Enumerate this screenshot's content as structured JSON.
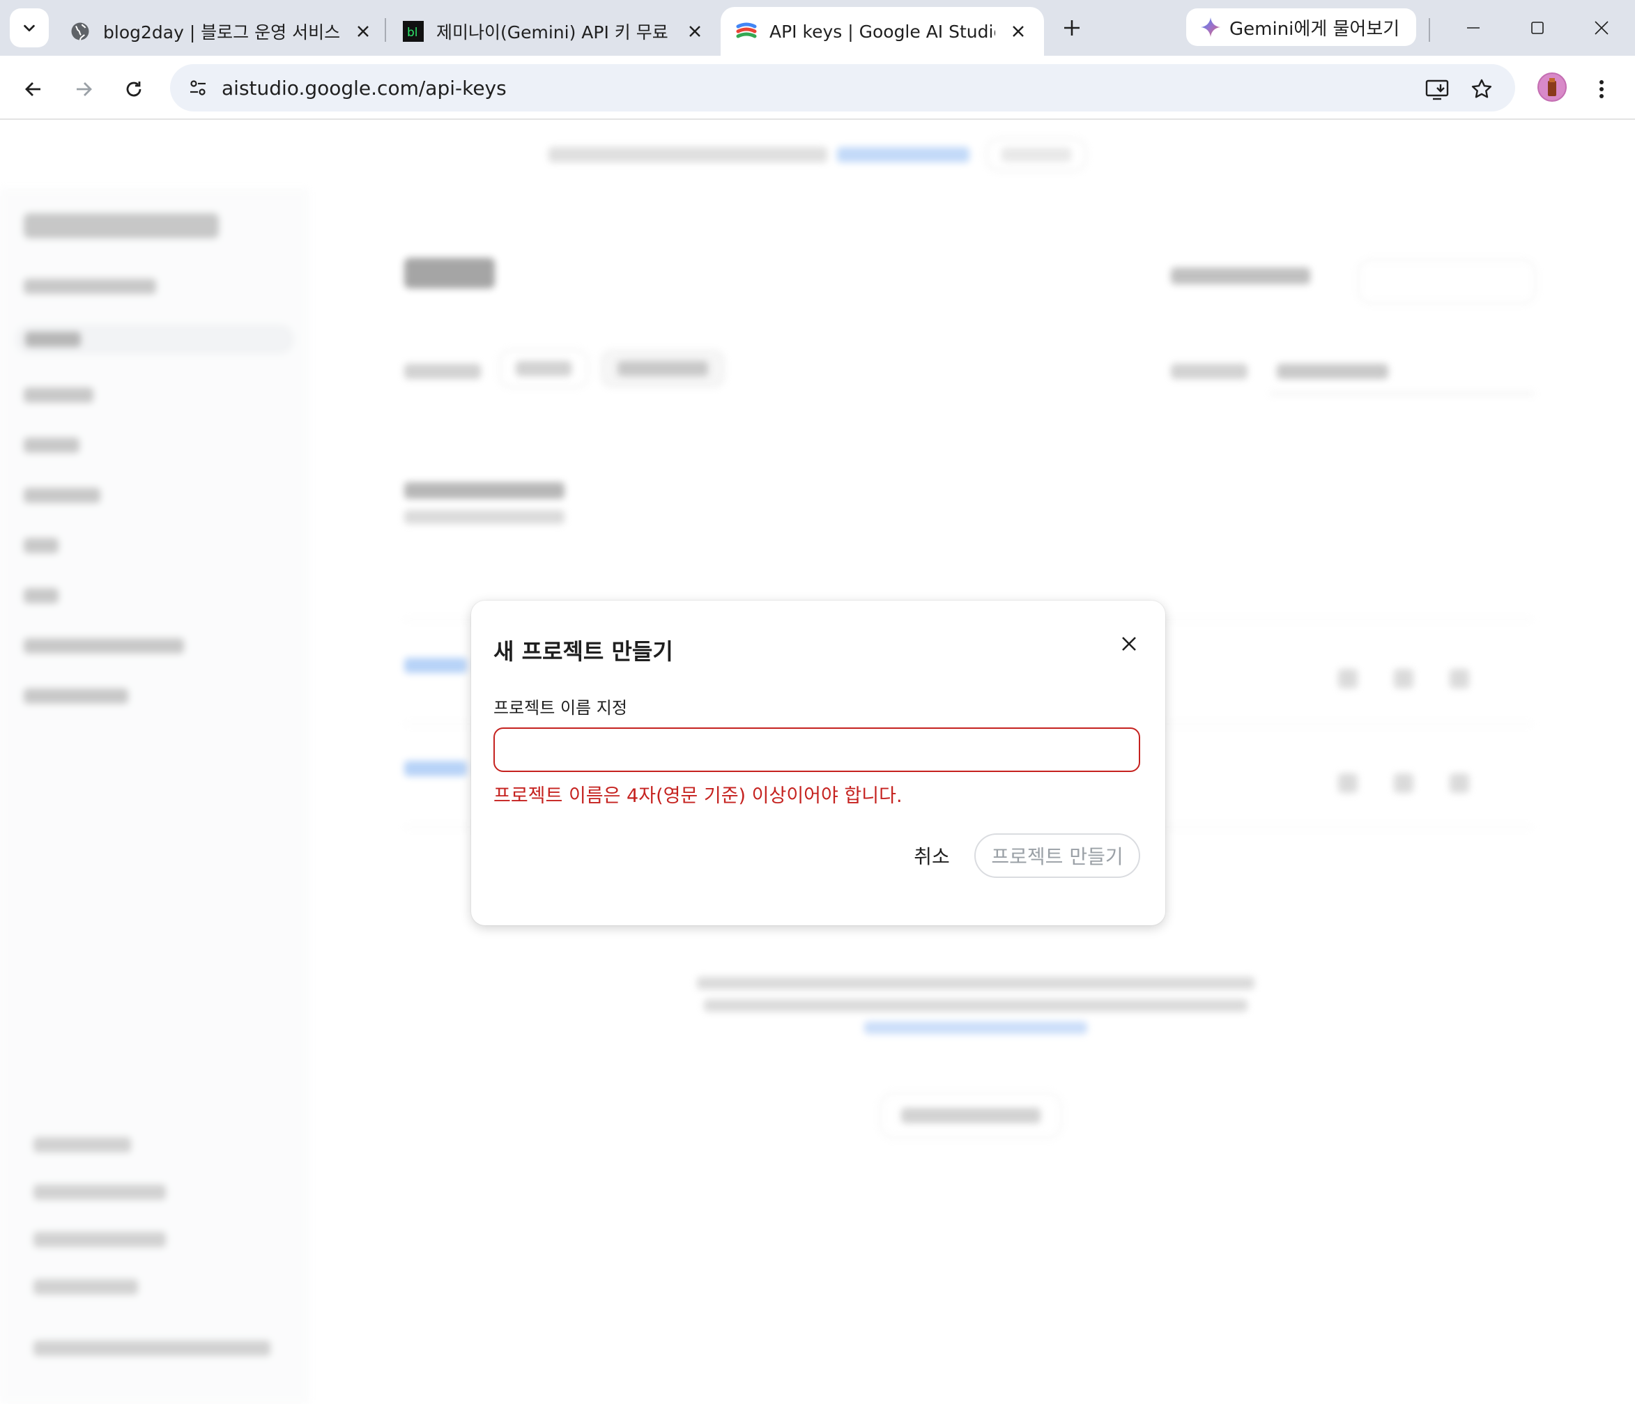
{
  "browser": {
    "tabs": [
      {
        "title": "blog2day | 블로그 운영 서비스",
        "favicon": "globe-icon"
      },
      {
        "title": "제미나이(Gemini) API 키 무료",
        "favicon": "bl-logo-icon"
      },
      {
        "title": "API keys | Google AI Studio",
        "favicon": "ai-studio-icon"
      }
    ],
    "gemini_button": "Gemini에게 물어보기",
    "url": "aistudio.google.com/api-keys"
  },
  "dialog": {
    "title": "새 프로젝트 만들기",
    "field_label": "프로젝트 이름 지정",
    "input_value": "",
    "error": "프로젝트 이름은 4자(영문 기준) 이상이어야 합니다.",
    "cancel_label": "취소",
    "create_label": "프로젝트 만들기"
  },
  "colors": {
    "error": "#c5221f",
    "accent": "#1a73e8"
  }
}
